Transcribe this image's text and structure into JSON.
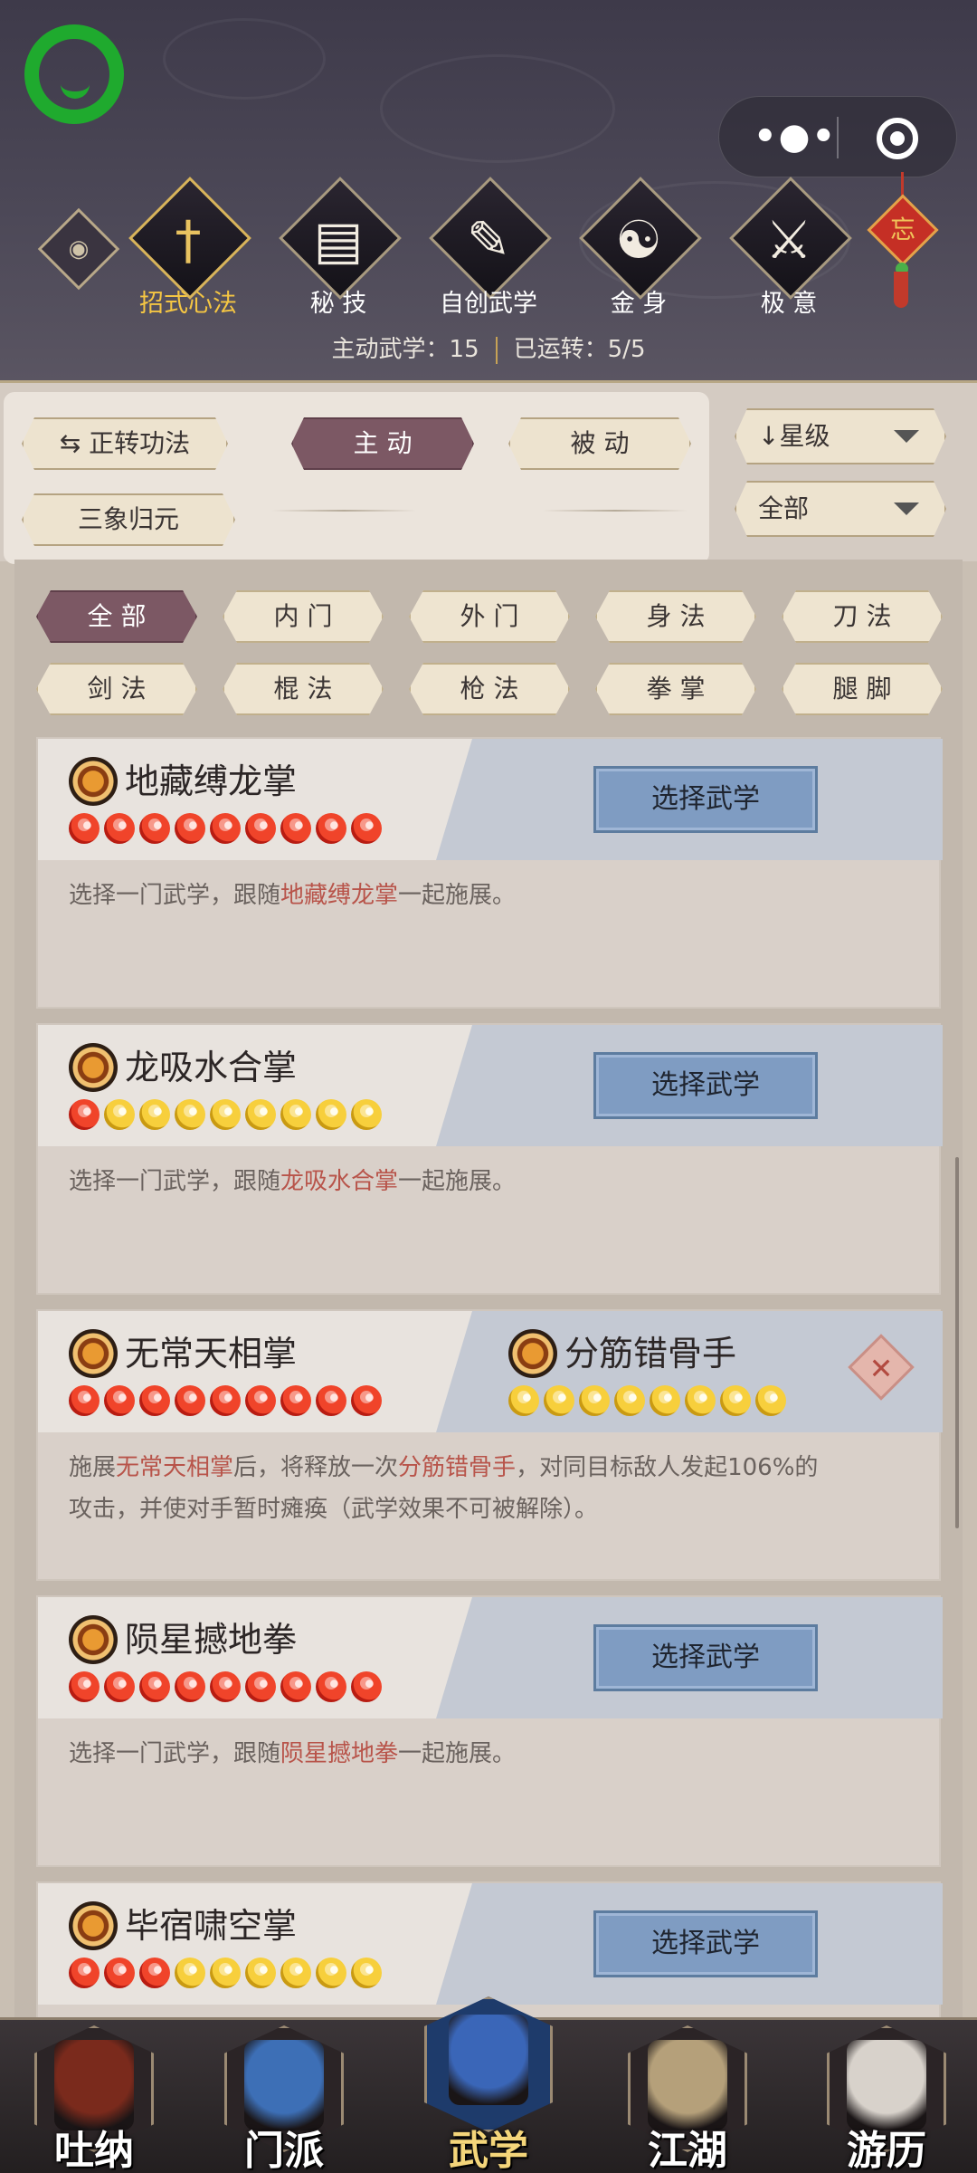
{
  "nav": {
    "items": [
      {
        "label": "招式心法",
        "icon": "sword-icon",
        "glyph": "†",
        "active": true
      },
      {
        "label": "秘 技",
        "icon": "book-icon",
        "glyph": "▤",
        "active": false
      },
      {
        "label": "自创武学",
        "icon": "scroll-icon",
        "glyph": "✎",
        "active": false
      },
      {
        "label": "金 身",
        "icon": "meditation-icon",
        "glyph": "☯",
        "active": false
      },
      {
        "label": "极 意",
        "icon": "fighter-stance-icon",
        "glyph": "⚔",
        "active": false
      }
    ],
    "charm_char": "忘"
  },
  "stats": {
    "active_label": "主动武学：",
    "active_value": "15",
    "running_label": "已运转：",
    "running_value": "5/5"
  },
  "filters": {
    "rotate_label": "正转功法",
    "tab_active": "主 动",
    "tab_passive": "被 动",
    "sanxiang_label": "三象归元",
    "sort_label": "星级",
    "sort_icon": "down-arrow-icon",
    "type_label": "全部"
  },
  "categories": [
    "全 部",
    "内 门",
    "外 门",
    "身 法",
    "刀 法",
    "剑 法",
    "棍 法",
    "枪 法",
    "拳 掌",
    "腿 脚"
  ],
  "cards": [
    {
      "name": "地藏缚龙掌",
      "orbs": [
        "red",
        "red",
        "red",
        "red",
        "red",
        "red",
        "red",
        "red",
        "red"
      ],
      "button": "选择武学",
      "desc_pre": "选择一门武学，跟随",
      "desc_hl": "地藏缚龙掌",
      "desc_post": "一起施展。"
    },
    {
      "name": "龙吸水合掌",
      "orbs": [
        "red",
        "gold",
        "gold",
        "gold",
        "gold",
        "gold",
        "gold",
        "gold",
        "gold"
      ],
      "button": "选择武学",
      "desc_pre": "选择一门武学，跟随",
      "desc_hl": "龙吸水合掌",
      "desc_post": "一起施展。"
    },
    {
      "name": "无常天相掌",
      "orbs": [
        "red",
        "red",
        "red",
        "red",
        "red",
        "red",
        "red",
        "red",
        "red"
      ],
      "partner_name": "分筋错骨手",
      "partner_orbs": [
        "gold",
        "gold",
        "gold",
        "gold",
        "gold",
        "gold",
        "gold",
        "gold"
      ],
      "remove_glyph": "✕",
      "desc_line1_a": "施展",
      "desc_line1_hl1": "无常天相掌",
      "desc_line1_b": "后，将释放一次",
      "desc_line1_hl2": "分筋错骨手",
      "desc_line1_c": "，对同目标敌人发起106%的",
      "desc_line2": "攻击，并使对手暂时瘫痪（武学效果不可被解除）。"
    },
    {
      "name": "陨星撼地拳",
      "orbs": [
        "red",
        "red",
        "red",
        "red",
        "red",
        "red",
        "red",
        "red",
        "red"
      ],
      "button": "选择武学",
      "desc_pre": "选择一门武学，跟随",
      "desc_hl": "陨星撼地拳",
      "desc_post": "一起施展。"
    },
    {
      "name": "毕宿啸空掌",
      "orbs": [
        "red",
        "red",
        "red",
        "gold",
        "gold",
        "gold",
        "gold",
        "gold",
        "gold"
      ],
      "button": "选择武学"
    }
  ],
  "tabbar": [
    {
      "label": "吐纳",
      "icon": "monk-icon",
      "color": "#7a2a1c",
      "active": false
    },
    {
      "label": "门派",
      "icon": "sect-flags-icon",
      "color": "#3d6fb6",
      "active": false
    },
    {
      "label": "武学",
      "icon": "manual-book-icon",
      "color": "#3a66b8",
      "active": true
    },
    {
      "label": "江湖",
      "icon": "straw-hat-icon",
      "color": "#b5a07a",
      "active": false
    },
    {
      "label": "游历",
      "icon": "white-horse-icon",
      "color": "#d8d2cb",
      "active": false
    }
  ]
}
